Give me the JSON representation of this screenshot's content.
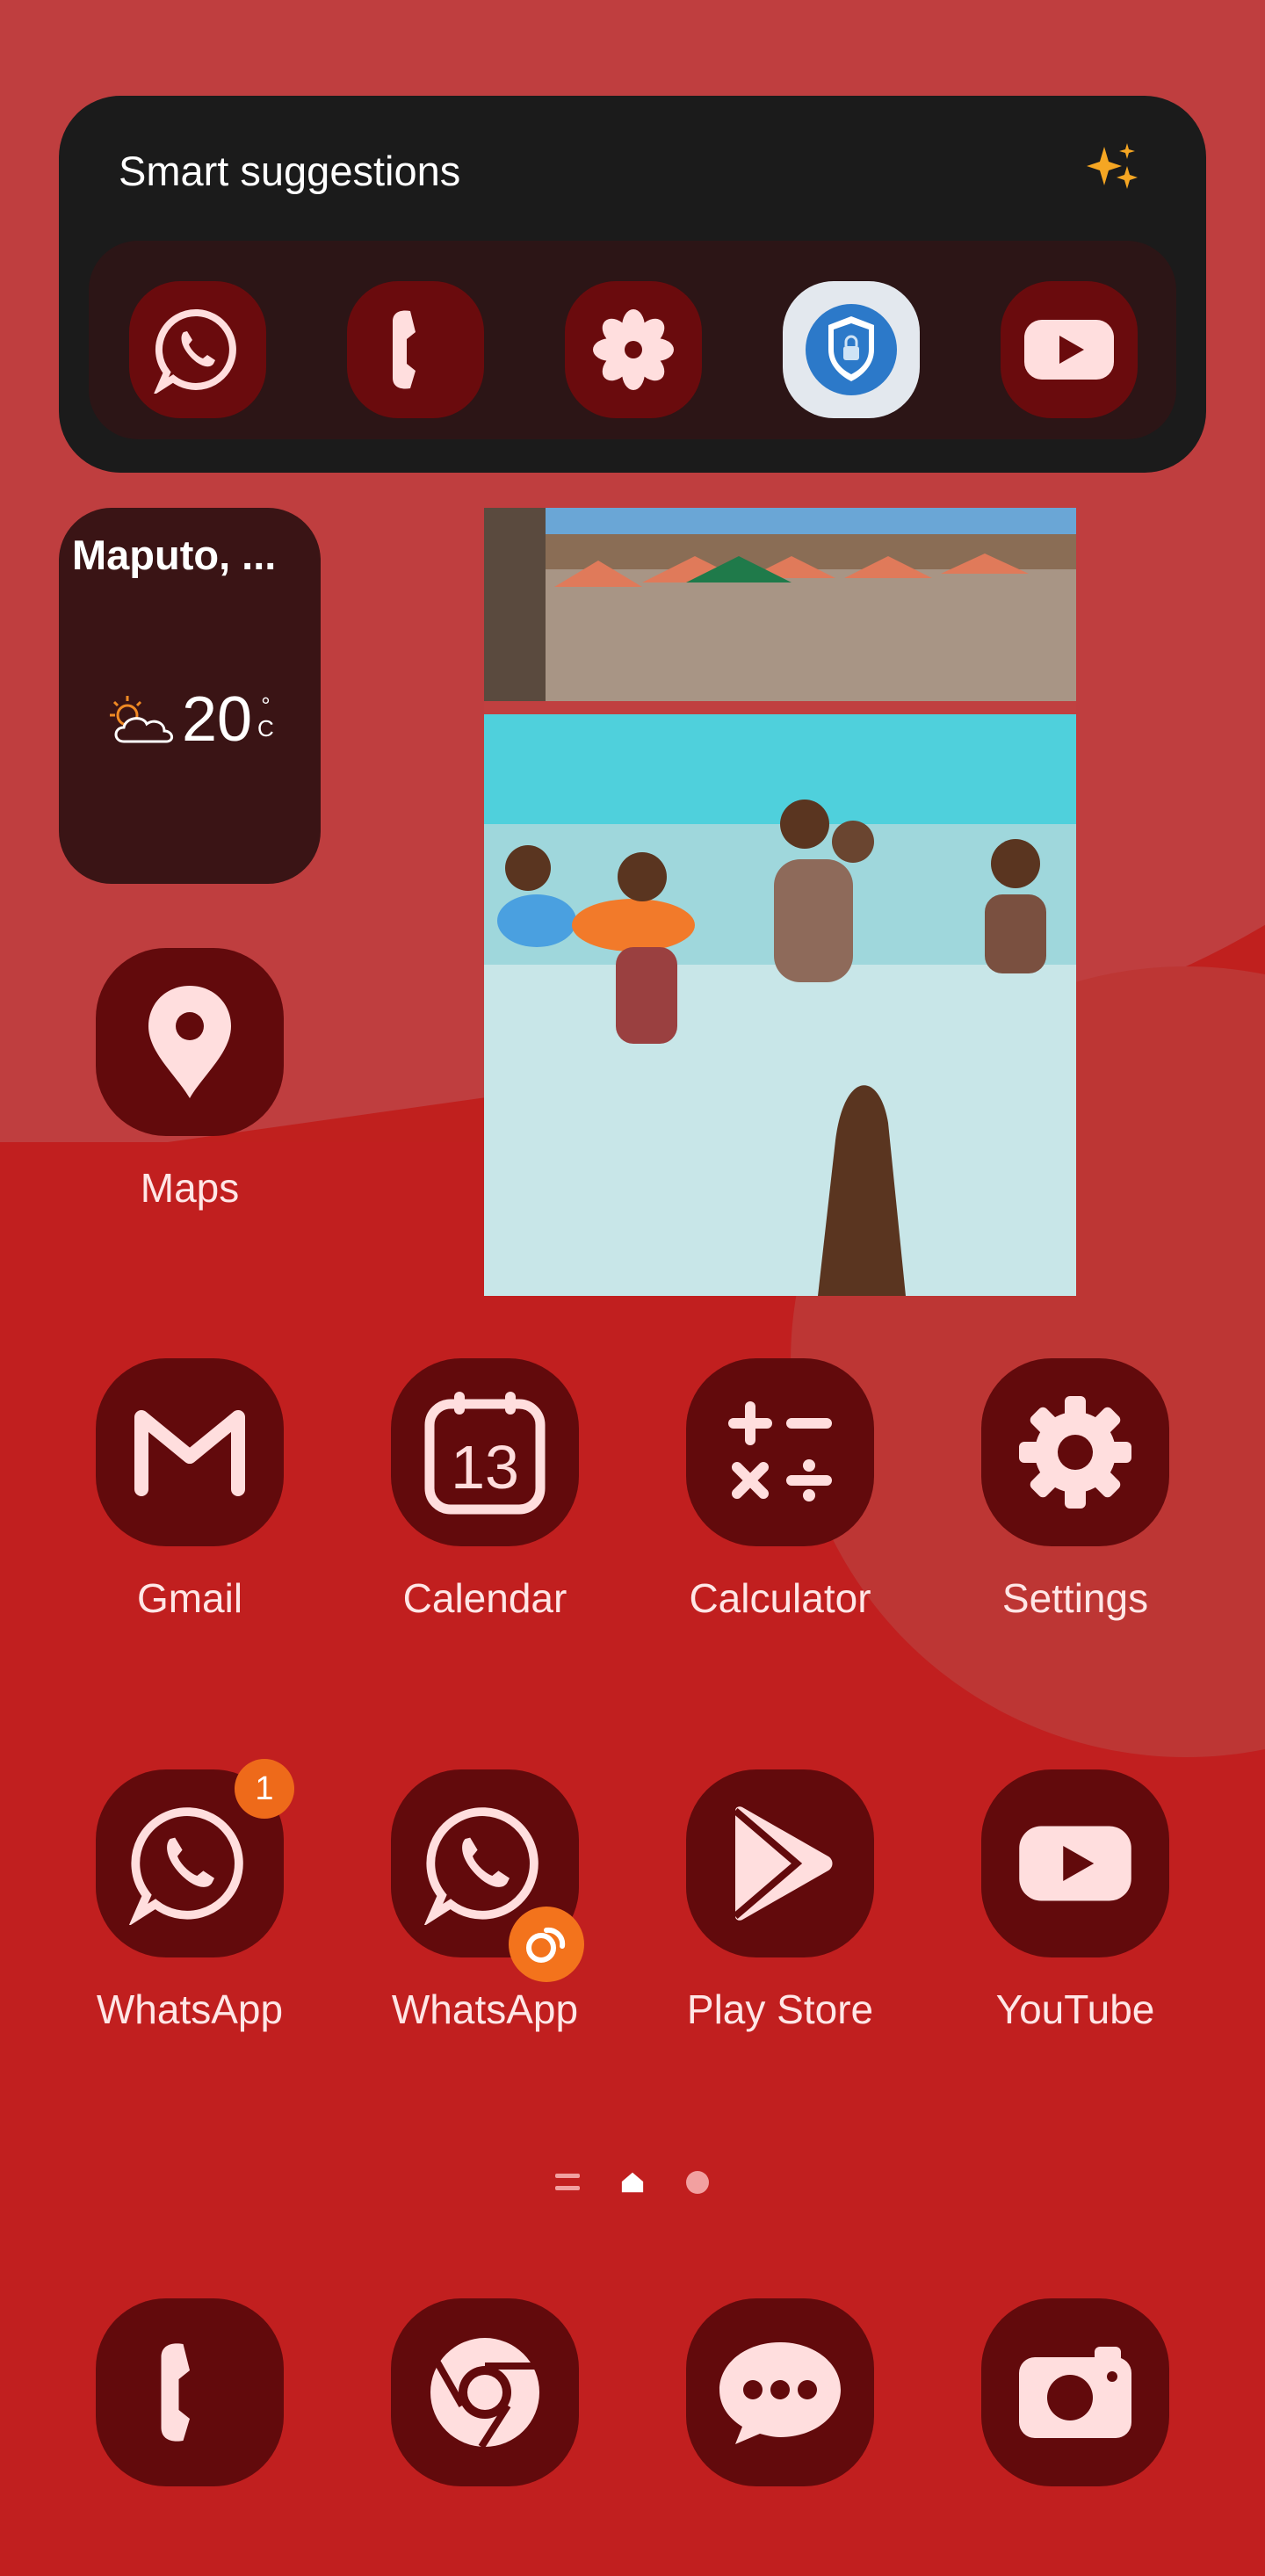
{
  "smart_suggestions": {
    "title": "Smart suggestions",
    "apps": [
      "whatsapp-icon",
      "phone-icon",
      "flower-app-icon",
      "secure-folder-icon",
      "youtube-icon"
    ]
  },
  "weather": {
    "city": "Maputo, ...",
    "temperature": "20",
    "unit_deg": "°",
    "unit_c": "C",
    "icon": "partly-cloudy-icon"
  },
  "photo": {
    "icon": "pool-photo"
  },
  "apps": {
    "maps": {
      "label": "Maps"
    },
    "gmail": {
      "label": "Gmail"
    },
    "calendar": {
      "label": "Calendar",
      "day": "13"
    },
    "calculator": {
      "label": "Calculator"
    },
    "settings": {
      "label": "Settings"
    },
    "whatsapp": {
      "label": "WhatsApp",
      "badge": "1"
    },
    "whatsapp_clone": {
      "label": "WhatsApp"
    },
    "play_store": {
      "label": "Play Store"
    },
    "youtube": {
      "label": "YouTube"
    }
  },
  "dock": [
    "phone-icon",
    "chrome-icon",
    "messages-icon",
    "camera-icon"
  ],
  "colors": {
    "background": "#c0201e",
    "icon_bg": "#620a0c",
    "glyph": "#ffdede",
    "badge": "#ee6a1a"
  }
}
